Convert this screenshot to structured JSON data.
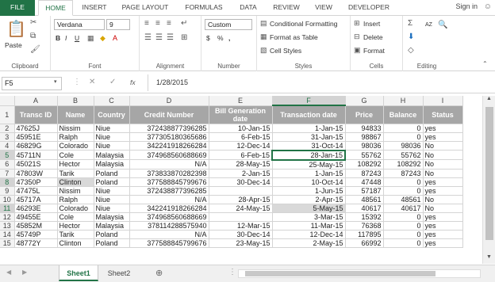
{
  "menu": {
    "tabs": [
      "FILE",
      "HOME",
      "INSERT",
      "PAGE LAYOUT",
      "FORMULAS",
      "DATA",
      "REVIEW",
      "VIEW",
      "DEVELOPER"
    ],
    "sign_in": "Sign in"
  },
  "ribbon": {
    "clipboard": {
      "label": "Clipboard",
      "paste": "Paste"
    },
    "font": {
      "label": "Font",
      "name": "Verdana",
      "size": "9",
      "bold": "B",
      "italic": "I",
      "underline": "U",
      "grow": "A",
      "shrink": "A"
    },
    "alignment": {
      "label": "Alignment"
    },
    "number": {
      "label": "Number",
      "format": "Custom",
      "currency": "$",
      "percent": "%",
      "comma": ","
    },
    "styles": {
      "label": "Styles",
      "conditional": "Conditional Formatting",
      "format_table": "Format as Table",
      "cell_styles": "Cell Styles"
    },
    "cells": {
      "label": "Cells",
      "insert": "Insert",
      "delete": "Delete",
      "format": "Format"
    },
    "editing": {
      "label": "Editing",
      "sort": "AZ",
      "find": "Find"
    }
  },
  "formula_bar": {
    "name_box": "F5",
    "fx": "fx",
    "value": "1/28/2015"
  },
  "columns": [
    "A",
    "B",
    "C",
    "D",
    "E",
    "F",
    "G",
    "H",
    "I"
  ],
  "header_row": [
    "Transc ID",
    "Name",
    "Country",
    "Credit Number",
    "Bill Generation date",
    "Transaction date",
    "Price",
    "Balance",
    "Status"
  ],
  "rows": [
    [
      "47625J",
      "Nissim",
      "Niue",
      "372438877396285",
      "10-Jan-15",
      "1-Jan-15",
      "94833",
      "0",
      "yes"
    ],
    [
      "45951E",
      "Ralph",
      "Niue",
      "377305180365686",
      "6-Feb-15",
      "31-Jan-15",
      "98867",
      "0",
      "yes"
    ],
    [
      "46829G",
      "Colorado",
      "Niue",
      "342241918266284",
      "12-Dec-14",
      "31-Oct-14",
      "98036",
      "98036",
      "No"
    ],
    [
      "45711N",
      "Cole",
      "Malaysia",
      "374968560688669",
      "6-Feb-15",
      "28-Jan-15",
      "55762",
      "55762",
      "No"
    ],
    [
      "45021S",
      "Hector",
      "Malaysia",
      "N/A",
      "28-May-15",
      "25-May-15",
      "108292",
      "108292",
      "No"
    ],
    [
      "47803W",
      "Tarik",
      "Poland",
      "373833870282398",
      "2-Jan-15",
      "1-Jan-15",
      "87243",
      "87243",
      "No"
    ],
    [
      "47350P",
      "Clinton",
      "Poland",
      "377588845799676",
      "30-Dec-14",
      "10-Oct-14",
      "47448",
      "0",
      "yes"
    ],
    [
      "47475L",
      "Nissim",
      "Niue",
      "372438877396285",
      "",
      "1-Jun-15",
      "57187",
      "0",
      "yes"
    ],
    [
      "45717A",
      "Ralph",
      "Niue",
      "N/A",
      "28-Apr-15",
      "2-Apr-15",
      "48561",
      "48561",
      "No"
    ],
    [
      "46293E",
      "Colorado",
      "Niue",
      "342241918266284",
      "24-May-15",
      "5-May-15",
      "40617",
      "40617",
      "No"
    ],
    [
      "49455E",
      "Cole",
      "Malaysia",
      "374968560688669",
      "",
      "3-Mar-15",
      "15392",
      "0",
      "yes"
    ],
    [
      "45852M",
      "Hector",
      "Malaysia",
      "378114288575940",
      "12-Mar-15",
      "11-Mar-15",
      "76368",
      "0",
      "yes"
    ],
    [
      "45749P",
      "Tarik",
      "Poland",
      "N/A",
      "30-Dec-14",
      "12-Dec-14",
      "117895",
      "0",
      "yes"
    ],
    [
      "48772Y",
      "Clinton",
      "Poland",
      "377588845799676",
      "23-May-15",
      "2-May-15",
      "66992",
      "0",
      "yes"
    ]
  ],
  "row_numbers": [
    "1",
    "2",
    "3",
    "4",
    "5",
    "6",
    "7",
    "8",
    "9",
    "10",
    "11",
    "12",
    "13",
    "14",
    "15"
  ],
  "sheets": [
    "Sheet1",
    "Sheet2"
  ],
  "active_sheet": "Sheet1",
  "colors": {
    "accent": "#217346",
    "header_fill": "#a6a6a6",
    "highlight": "#d9d9d9"
  }
}
